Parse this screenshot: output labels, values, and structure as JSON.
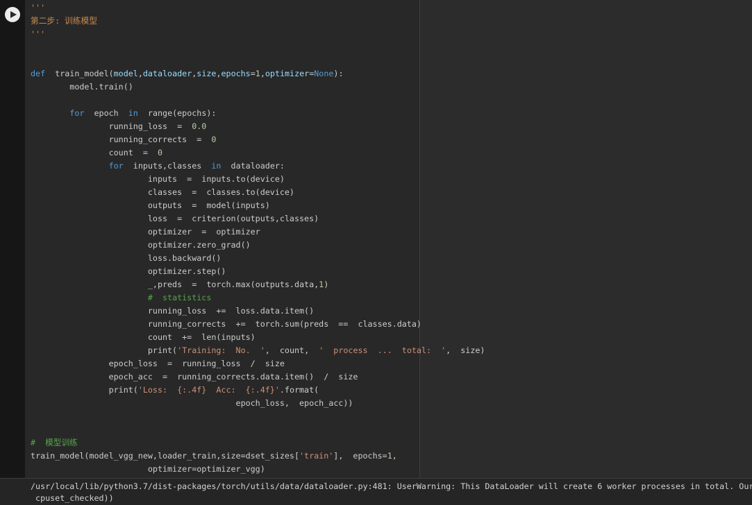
{
  "cell": {
    "run_button": {
      "icon": "play-icon"
    },
    "code_lines": [
      [
        {
          "t": "'''",
          "c": "doc"
        }
      ],
      [
        {
          "t": "第二步: 训练模型",
          "c": "doc"
        }
      ],
      [
        {
          "t": "'''",
          "c": "doc"
        }
      ],
      [],
      [],
      [
        {
          "t": "def",
          "c": "kw"
        },
        {
          "t": "  train_model(",
          "c": "pl"
        },
        {
          "t": "model",
          "c": "par"
        },
        {
          "t": ",",
          "c": "pl"
        },
        {
          "t": "dataloader",
          "c": "par"
        },
        {
          "t": ",",
          "c": "pl"
        },
        {
          "t": "size",
          "c": "par"
        },
        {
          "t": ",",
          "c": "pl"
        },
        {
          "t": "epochs",
          "c": "par"
        },
        {
          "t": "=",
          "c": "pl"
        },
        {
          "t": "1",
          "c": "num"
        },
        {
          "t": ",",
          "c": "pl"
        },
        {
          "t": "optimizer",
          "c": "par"
        },
        {
          "t": "=",
          "c": "pl"
        },
        {
          "t": "None",
          "c": "kw"
        },
        {
          "t": "):",
          "c": "pl"
        }
      ],
      [
        {
          "t": "        model.train()",
          "c": "pl"
        }
      ],
      [],
      [
        {
          "t": "        ",
          "c": "pl"
        },
        {
          "t": "for",
          "c": "kw"
        },
        {
          "t": "  epoch  ",
          "c": "pl"
        },
        {
          "t": "in",
          "c": "kw"
        },
        {
          "t": "  range(epochs):",
          "c": "pl"
        }
      ],
      [
        {
          "t": "                running_loss  =  ",
          "c": "pl"
        },
        {
          "t": "0.0",
          "c": "num"
        }
      ],
      [
        {
          "t": "                running_corrects  =  ",
          "c": "pl"
        },
        {
          "t": "0",
          "c": "num"
        }
      ],
      [
        {
          "t": "                count  =  ",
          "c": "pl"
        },
        {
          "t": "0",
          "c": "num"
        }
      ],
      [
        {
          "t": "                ",
          "c": "pl"
        },
        {
          "t": "for",
          "c": "kw"
        },
        {
          "t": "  inputs,classes  ",
          "c": "pl"
        },
        {
          "t": "in",
          "c": "kw"
        },
        {
          "t": "  dataloader:",
          "c": "pl"
        }
      ],
      [
        {
          "t": "                        inputs  =  inputs.to(device)",
          "c": "pl"
        }
      ],
      [
        {
          "t": "                        classes  =  classes.to(device)",
          "c": "pl"
        }
      ],
      [
        {
          "t": "                        outputs  =  model(inputs)",
          "c": "pl"
        }
      ],
      [
        {
          "t": "                        loss  =  criterion(outputs,classes)",
          "c": "pl"
        }
      ],
      [
        {
          "t": "                        optimizer  =  optimizer",
          "c": "pl"
        }
      ],
      [
        {
          "t": "                        optimizer.zero_grad()",
          "c": "pl"
        }
      ],
      [
        {
          "t": "                        loss.backward()",
          "c": "pl"
        }
      ],
      [
        {
          "t": "                        optimizer.step()",
          "c": "pl"
        }
      ],
      [
        {
          "t": "                        _,preds  =  torch.max(outputs.data,",
          "c": "pl"
        },
        {
          "t": "1",
          "c": "num"
        },
        {
          "t": ")",
          "c": "pl"
        }
      ],
      [
        {
          "t": "                        ",
          "c": "pl"
        },
        {
          "t": "#  statistics",
          "c": "com"
        }
      ],
      [
        {
          "t": "                        running_loss  +=  loss.data.item()",
          "c": "pl"
        }
      ],
      [
        {
          "t": "                        running_corrects  +=  torch.sum(preds  ==  classes.data)",
          "c": "pl"
        }
      ],
      [
        {
          "t": "                        count  +=  len(inputs)",
          "c": "pl"
        }
      ],
      [
        {
          "t": "                        print(",
          "c": "pl"
        },
        {
          "t": "'Training:  No.  '",
          "c": "str"
        },
        {
          "t": ",  count,  ",
          "c": "pl"
        },
        {
          "t": "'  process  ...  total:  '",
          "c": "str"
        },
        {
          "t": ",  size)",
          "c": "pl"
        }
      ],
      [
        {
          "t": "                epoch_loss  =  running_loss  /  size",
          "c": "pl"
        }
      ],
      [
        {
          "t": "                epoch_acc  =  running_corrects.data.item()  /  size",
          "c": "pl"
        }
      ],
      [
        {
          "t": "                print(",
          "c": "pl"
        },
        {
          "t": "'Loss:  {:.4f}  Acc:  {:.4f}'",
          "c": "str"
        },
        {
          "t": ".format(",
          "c": "pl"
        }
      ],
      [
        {
          "t": "                                          epoch_loss,  epoch_acc))",
          "c": "pl"
        }
      ],
      [],
      [],
      [
        {
          "t": "#  模型训练",
          "c": "com"
        }
      ],
      [
        {
          "t": "train_model(model_vgg_new,loader_train,size=dset_sizes[",
          "c": "pl"
        },
        {
          "t": "'train'",
          "c": "str"
        },
        {
          "t": "],  epochs=",
          "c": "pl"
        },
        {
          "t": "1",
          "c": "num"
        },
        {
          "t": ",",
          "c": "pl"
        }
      ],
      [
        {
          "t": "                        optimizer=optimizer_vgg)",
          "c": "pl"
        }
      ]
    ]
  },
  "output": {
    "lines": [
      "/usr/local/lib/python3.7/dist-packages/torch/utils/data/dataloader.py:481: UserWarning: This DataLoader will create 6 worker processes in total. Our",
      " cpuset_checked))"
    ]
  },
  "colors": {
    "editor_background": "#282828",
    "gutter_background": "#161616",
    "ruler_line": "#3d3d3d",
    "output_background": "#252525",
    "plain_text": "#cdcdcd",
    "keyword": "#569cd6",
    "string": "#ce9178",
    "docstring": "#c98a4e",
    "comment": "#55a64a",
    "number": "#b5cea8",
    "parameter": "#9cdcfe"
  }
}
